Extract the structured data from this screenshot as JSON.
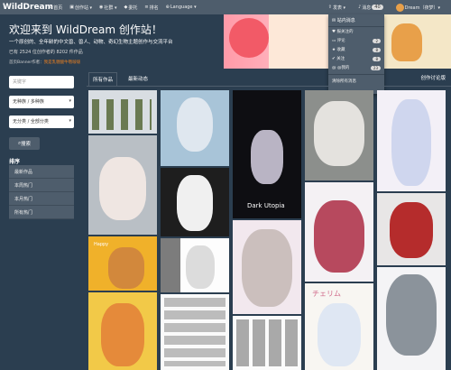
{
  "navbar": {
    "brand": "WildDream",
    "items": [
      "首页",
      "创作站 ▾",
      "社群 ▾",
      "委托",
      "排名",
      "Language ▾"
    ],
    "right": {
      "content_label": "发表 ▾",
      "messages_label": "消息",
      "messages_count": "40",
      "user_label": "Dream（夜梦）▾"
    }
  },
  "hero": {
    "title": "欢迎来到 WildDream 创作站！",
    "subtitle": "一个原创的、全年龄的中文兽、兽人、动物、奇幻生物主题创作与交流平台",
    "stats": "已有 2524 位创作者的 8202 件作品",
    "banner_prefix": "首页Banner作者：",
    "banner_link": "我是乳糖酸牛哦啵啵"
  },
  "dropdown": {
    "header": "站内消息",
    "rows": [
      {
        "label": "报关注的",
        "count": ""
      },
      {
        "label": "评论",
        "count": "2"
      },
      {
        "label": "收藏",
        "count": "8"
      },
      {
        "label": "关注",
        "count": "8"
      },
      {
        "label": "@我的",
        "count": "23"
      }
    ],
    "clear": "清除所有消息"
  },
  "filters": {
    "search_placeholder": "关键字",
    "select1": "无种族 / 多种族",
    "select2": "无分类",
    "select3": "无分类 / 全部分类",
    "search_button": "搜索",
    "sort_label": "排序",
    "sort_items": [
      "最新作品",
      "本周热门",
      "本月热门",
      "所有热门"
    ]
  },
  "tabs": {
    "all": "所有作品",
    "latest": "最新动态",
    "right": "创作讨论版"
  },
  "tile_text": {
    "dark_utopia": "Dark Utopia",
    "cherry": "チェリム",
    "happy": "Happy"
  }
}
